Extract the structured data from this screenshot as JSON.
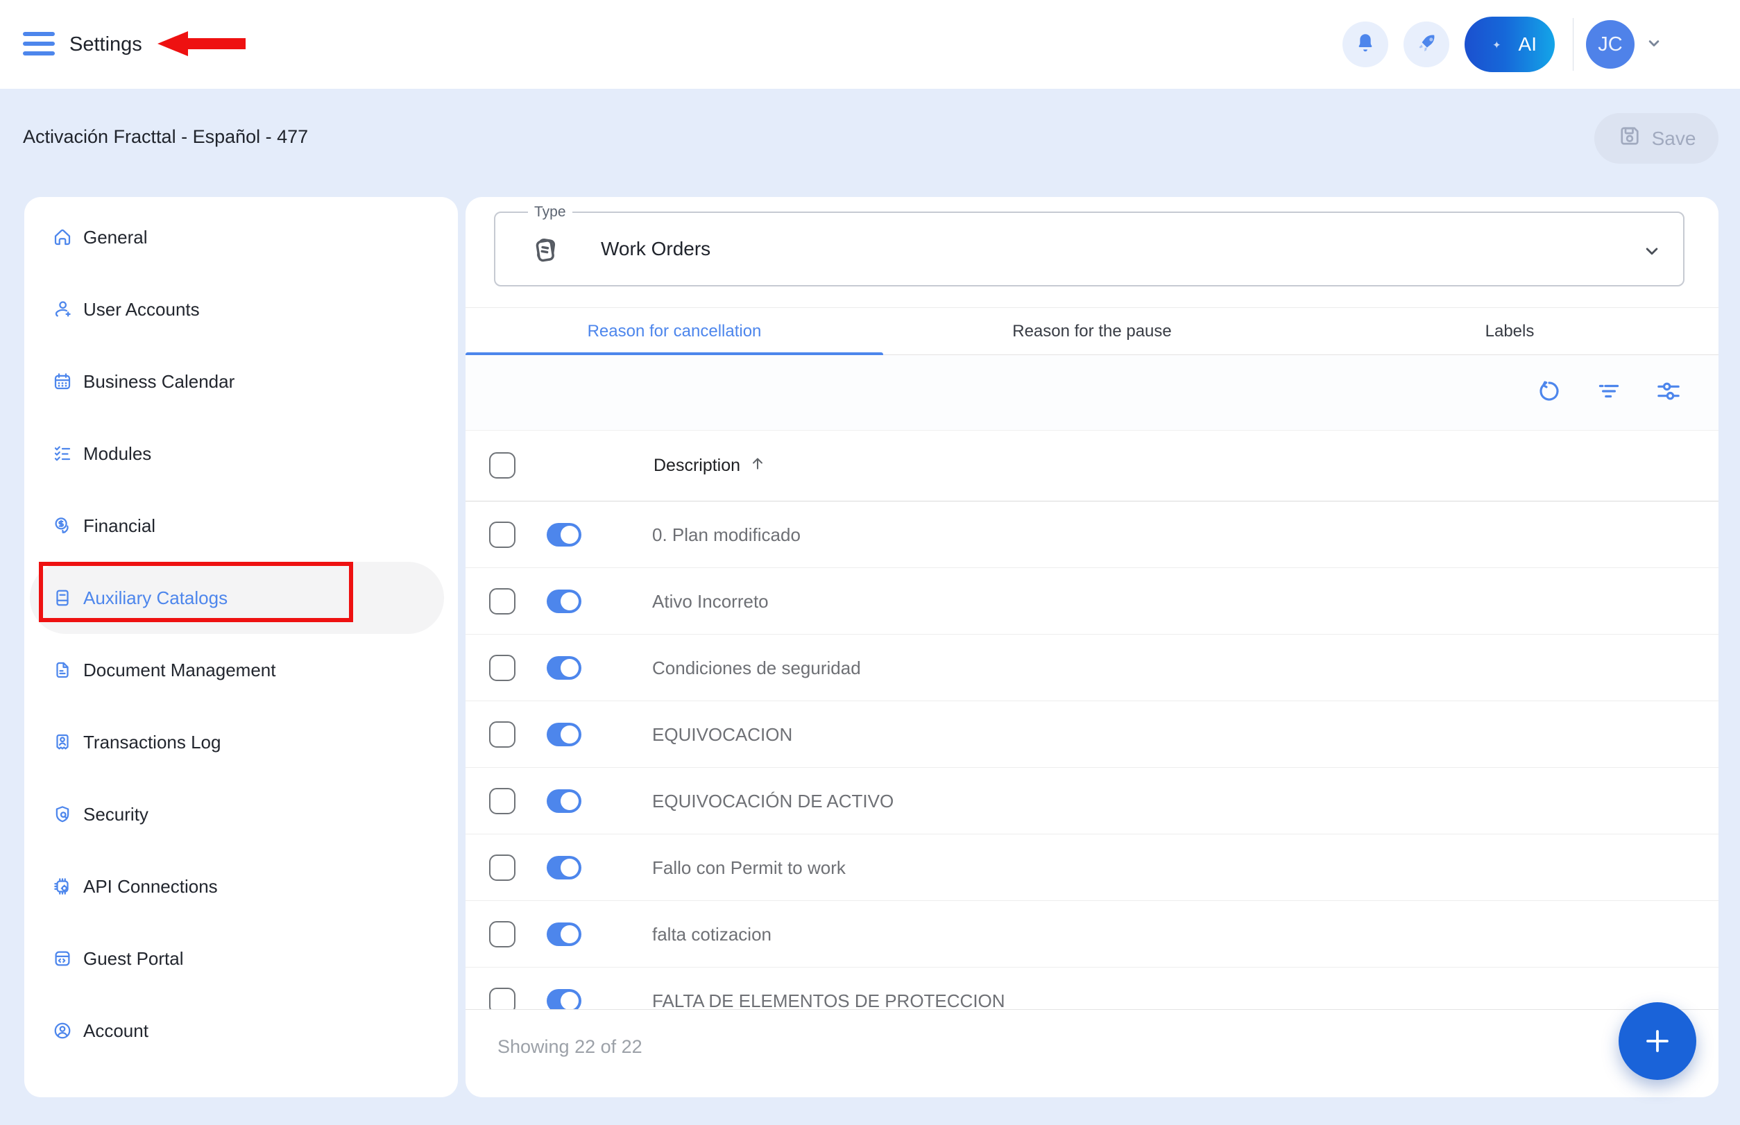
{
  "colors": {
    "accent": "#4d86ec",
    "fab": "#1a63d9",
    "annotation_red": "#ee1111",
    "page_bg": "#e4ecfa"
  },
  "header": {
    "title": "Settings",
    "ai_button_label": "AI",
    "avatar_initials": "JC"
  },
  "subheader": {
    "breadcrumb": "Activación Fracttal - Español - 477",
    "save_label": "Save"
  },
  "sidebar": {
    "items": [
      {
        "label": "General",
        "icon": "home-icon",
        "active": false
      },
      {
        "label": "User Accounts",
        "icon": "user-plus-icon",
        "active": false
      },
      {
        "label": "Business Calendar",
        "icon": "calendar-icon",
        "active": false
      },
      {
        "label": "Modules",
        "icon": "checklist-icon",
        "active": false
      },
      {
        "label": "Financial",
        "icon": "dollar-coin-icon",
        "active": false
      },
      {
        "label": "Auxiliary Catalogs",
        "icon": "journal-icon",
        "active": true
      },
      {
        "label": "Document Management",
        "icon": "document-icon",
        "active": false
      },
      {
        "label": "Transactions Log",
        "icon": "id-badge-icon",
        "active": false
      },
      {
        "label": "Security",
        "icon": "shield-icon",
        "active": false
      },
      {
        "label": "API Connections",
        "icon": "chip-gear-icon",
        "active": false
      },
      {
        "label": "Guest Portal",
        "icon": "browser-code-icon",
        "active": false
      },
      {
        "label": "Account",
        "icon": "user-circle-icon",
        "active": false
      }
    ]
  },
  "main": {
    "type_field": {
      "label": "Type",
      "value": "Work Orders"
    },
    "tabs": [
      {
        "label": "Reason for cancellation",
        "active": true
      },
      {
        "label": "Reason for the pause",
        "active": false
      },
      {
        "label": "Labels",
        "active": false
      }
    ],
    "table": {
      "description_header": "Description",
      "sort": "ascending",
      "rows": [
        {
          "description": "0. Plan modificado",
          "enabled": true
        },
        {
          "description": "Ativo Incorreto",
          "enabled": true
        },
        {
          "description": "Condiciones de seguridad",
          "enabled": true
        },
        {
          "description": "EQUIVOCACION",
          "enabled": true
        },
        {
          "description": "EQUIVOCACIÓN DE ACTIVO",
          "enabled": true
        },
        {
          "description": "Fallo con Permit to work",
          "enabled": true
        },
        {
          "description": "falta cotizacion",
          "enabled": true
        },
        {
          "description": "FALTA DE ELEMENTOS DE PROTECCION",
          "enabled": true
        }
      ]
    },
    "footer": {
      "showing_text": "Showing 22 of 22"
    }
  }
}
